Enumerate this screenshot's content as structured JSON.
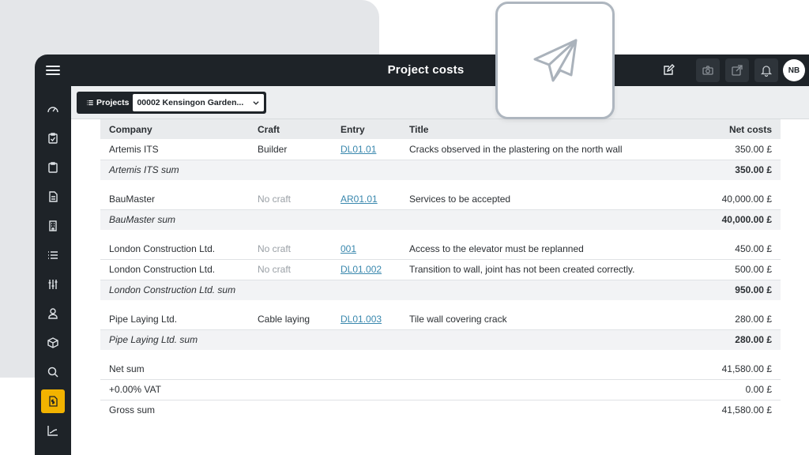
{
  "header": {
    "title": "Project costs",
    "avatar_initials": "NB"
  },
  "toolbar": {
    "projects_label": "Projects",
    "project_value": "00002 Kensingon Garden..."
  },
  "table": {
    "columns": [
      "Company",
      "Craft",
      "Entry",
      "Title",
      "Net costs"
    ],
    "groups": [
      {
        "rows": [
          {
            "company": "Artemis ITS",
            "craft": "Builder",
            "entry": "DL01.01",
            "title": "Cracks observed in the plastering on the north wall",
            "net": "350.00 £"
          }
        ],
        "sum_label": "Artemis ITS sum",
        "sum_value": "350.00 £"
      },
      {
        "rows": [
          {
            "company": "BauMaster",
            "craft": "No craft",
            "entry": "AR01.01",
            "title": "Services to be accepted",
            "net": "40,000.00 £"
          }
        ],
        "sum_label": "BauMaster sum",
        "sum_value": "40,000.00 £"
      },
      {
        "rows": [
          {
            "company": "London Construction Ltd.",
            "craft": "No craft",
            "entry": "001",
            "title": "Access to the elevator must be replanned",
            "net": "450.00 £"
          },
          {
            "company": "London Construction Ltd.",
            "craft": "No craft",
            "entry": "DL01.002",
            "title": "Transition to wall, joint has not been created correctly.",
            "net": "500.00 £"
          }
        ],
        "sum_label": "London Construction Ltd. sum",
        "sum_value": "950.00 £"
      },
      {
        "rows": [
          {
            "company": "Pipe Laying Ltd.",
            "craft": "Cable laying",
            "entry": "DL01.003",
            "title": "Tile wall covering crack",
            "net": "280.00 £"
          }
        ],
        "sum_label": "Pipe Laying Ltd. sum",
        "sum_value": "280.00 £"
      }
    ],
    "totals": [
      {
        "label": "Net sum",
        "value": "41,580.00 £"
      },
      {
        "label": "+0.00% VAT",
        "value": "0.00 £"
      },
      {
        "label": "Gross sum",
        "value": "41,580.00 £"
      }
    ]
  },
  "colors": {
    "dark": "#1e2328",
    "accent": "#f2b300",
    "link": "#3a88ae"
  },
  "icons": {
    "topbar": [
      "menu-icon",
      "edit-icon",
      "camera-icon",
      "export-icon",
      "bell-icon"
    ],
    "sidebar": [
      "dashboard-icon",
      "clipboard-check-icon",
      "clipboard-icon",
      "document-icon",
      "building-icon",
      "list-icon",
      "sliders-icon",
      "user-icon",
      "cube-icon",
      "search-icon",
      "invoice-icon",
      "chart-icon"
    ],
    "overlay": "paper-plane-icon"
  }
}
